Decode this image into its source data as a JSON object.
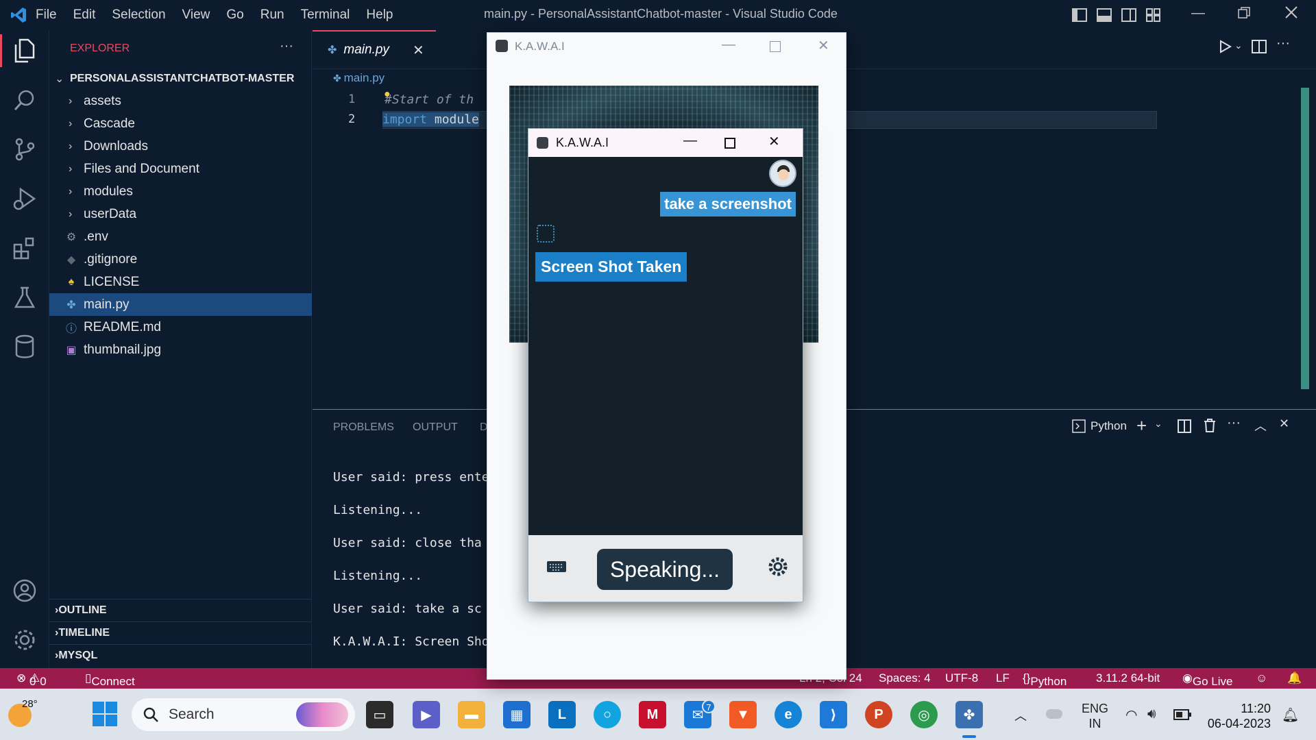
{
  "titlebar": {
    "menu": [
      "File",
      "Edit",
      "Selection",
      "View",
      "Go",
      "Run",
      "Terminal",
      "Help"
    ],
    "window_title": "main.py - PersonalAssistantChatbot-master - Visual Studio Code"
  },
  "sidebar": {
    "header": "EXPLORER",
    "root": "PERSONALASSISTANTCHATBOT-MASTER",
    "items": [
      {
        "label": "assets",
        "kind": "folder"
      },
      {
        "label": "Cascade",
        "kind": "folder"
      },
      {
        "label": "Downloads",
        "kind": "folder"
      },
      {
        "label": "Files and Document",
        "kind": "folder"
      },
      {
        "label": "modules",
        "kind": "folder"
      },
      {
        "label": "userData",
        "kind": "folder"
      },
      {
        "label": ".env",
        "kind": "gear-icon"
      },
      {
        "label": ".gitignore",
        "kind": "git-icon"
      },
      {
        "label": "LICENSE",
        "kind": "license-icon"
      },
      {
        "label": "main.py",
        "kind": "python-icon",
        "selected": true
      },
      {
        "label": "README.md",
        "kind": "info-icon"
      },
      {
        "label": "thumbnail.jpg",
        "kind": "image-icon"
      }
    ],
    "sections": [
      "OUTLINE",
      "TIMELINE",
      "MYSQL"
    ]
  },
  "editor": {
    "tab_label": "main.py",
    "breadcrumb": "main.py",
    "line_numbers": [
      "1",
      "2"
    ],
    "line1": "#Start of th",
    "line2_kw": "import",
    "line2_rest": " module"
  },
  "panel": {
    "tabs": [
      "PROBLEMS",
      "OUTPUT",
      "D"
    ],
    "terminal_label": "Python",
    "lines": [
      "User said: press ente",
      "Listening...",
      "User said: close tha",
      "Listening...",
      "User said: take a sc",
      "K.A.W.A.I: Screen Sho"
    ]
  },
  "statusbar": {
    "errors": "0",
    "warnings": "0",
    "connect": "Connect",
    "position": "Ln 2, Col 24",
    "spaces": "Spaces: 4",
    "encoding": "UTF-8",
    "eol": "LF",
    "language": "Python",
    "interpreter": "3.11.2 64-bit",
    "golive": "Go Live"
  },
  "outer_window": {
    "title": "K.A.W.A.I"
  },
  "inner_window": {
    "title": "K.A.W.A.I",
    "user_message": "take a screenshot",
    "bot_message": "Screen Shot Taken",
    "speaking": "Speaking..."
  },
  "taskbar": {
    "weather": "28°",
    "search": "Search",
    "lang1": "ENG",
    "lang2": "IN",
    "time": "11:20",
    "date": "06-04-2023",
    "badge": "7"
  },
  "colors": {
    "accent": "#e84a5f",
    "statusbar": "#9b1b4f",
    "selection": "#1c4a7e",
    "bubble_user": "#3795d6",
    "bubble_bot": "#1b7fc8"
  }
}
